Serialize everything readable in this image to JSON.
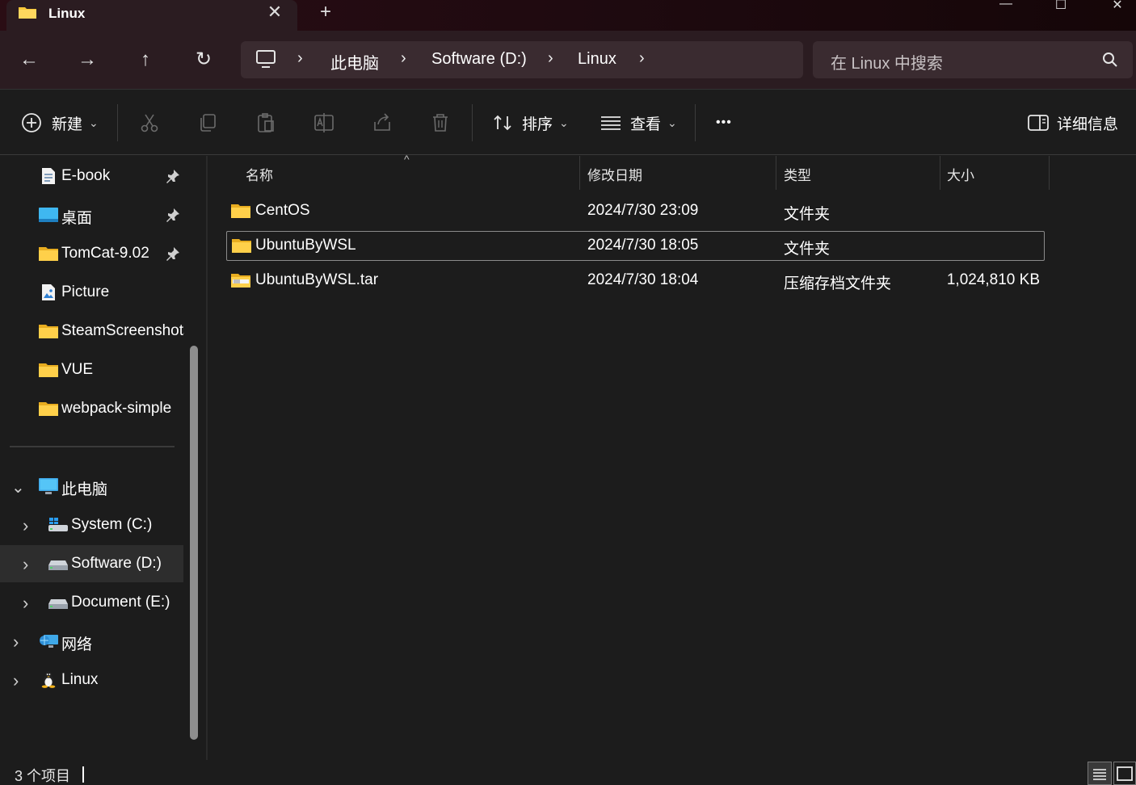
{
  "titlebar": {
    "tab_title": "Linux",
    "close_tab_symbol": "✕",
    "new_tab_symbol": "+",
    "minimize_symbol": "—",
    "maximize_symbol": "☐",
    "close_window_symbol": "✕"
  },
  "nav": {
    "back_symbol": "←",
    "forward_symbol": "→",
    "up_symbol": "↑",
    "refresh_symbol": "↻",
    "breadcrumbs": [
      "此电脑",
      "Software (D:)",
      "Linux"
    ],
    "separator": "›",
    "search_placeholder": "在 Linux 中搜索"
  },
  "toolbar": {
    "new_label": "新建",
    "sort_label": "排序",
    "view_label": "查看",
    "more_label": "•••",
    "details_label": "详细信息",
    "dropdown_symbol": "⌄"
  },
  "sidebar": {
    "quick_access": [
      {
        "label": "E-book",
        "icon": "document-icon",
        "pinned": true
      },
      {
        "label": "桌面",
        "icon": "desktop-icon",
        "pinned": true
      },
      {
        "label": "TomCat-9.02",
        "icon": "folder-icon",
        "pinned": true
      },
      {
        "label": "Picture",
        "icon": "picture-icon",
        "pinned": false
      },
      {
        "label": "SteamScreenshots",
        "icon": "folder-icon",
        "pinned": false
      },
      {
        "label": "VUE",
        "icon": "folder-icon",
        "pinned": false
      },
      {
        "label": "webpack-simple",
        "icon": "folder-icon",
        "pinned": false
      }
    ],
    "this_pc": {
      "label": "此电脑",
      "icon": "computer-icon"
    },
    "drives": [
      {
        "label": "System (C:)",
        "icon": "windows-drive-icon"
      },
      {
        "label": "Software (D:)",
        "icon": "drive-icon"
      },
      {
        "label": "Document (E:)",
        "icon": "drive-icon"
      }
    ],
    "network": {
      "label": "网络",
      "icon": "network-icon"
    },
    "linux": {
      "label": "Linux",
      "icon": "linux-penguin-icon"
    },
    "expand_symbol": "›",
    "collapse_symbol": "⌄"
  },
  "columns": {
    "name": "名称",
    "modified": "修改日期",
    "type": "类型",
    "size": "大小",
    "sort_caret": "^"
  },
  "files": [
    {
      "name": "CentOS",
      "modified": "2024/7/30 23:09",
      "type": "文件夹",
      "size": "",
      "icon": "folder-icon"
    },
    {
      "name": "UbuntuByWSL",
      "modified": "2024/7/30 18:05",
      "type": "文件夹",
      "size": "",
      "icon": "folder-icon"
    },
    {
      "name": "UbuntuByWSL.tar",
      "modified": "2024/7/30 18:04",
      "type": "压缩存档文件夹",
      "size": "1,024,810 KB",
      "icon": "zip-folder-icon"
    }
  ],
  "status": {
    "item_count": "3 个项目"
  },
  "colors": {
    "accent_titlebar": "#2a0d14",
    "folder_yellow": "#f8c83a",
    "background": "#1c1c1c"
  }
}
